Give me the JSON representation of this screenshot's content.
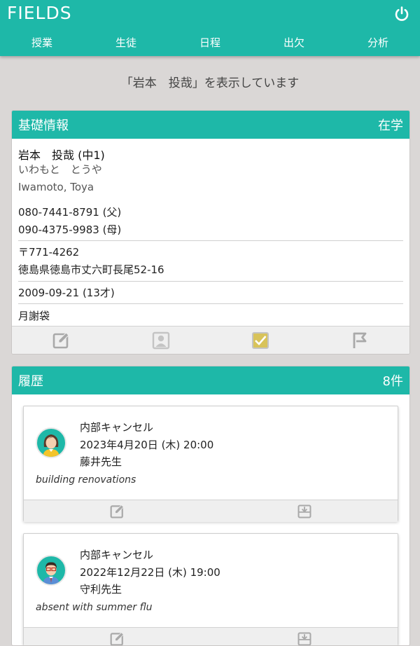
{
  "app": {
    "title": "FIELDS"
  },
  "nav": [
    {
      "label": "授業"
    },
    {
      "label": "生徒"
    },
    {
      "label": "日程"
    },
    {
      "label": "出欠"
    },
    {
      "label": "分析"
    }
  ],
  "message": "「岩本　投哉」を表示しています",
  "basic": {
    "header": "基礎情報",
    "status": "在学",
    "name": "岩本　投哉 (中1)",
    "kana": "いわもと　とうや",
    "roman": "Iwamoto, Toya",
    "phones": [
      "080-7441-8791 (父)",
      "090-4375-9983 (母)"
    ],
    "postal": "〒771-4262",
    "address": "徳島県徳島市丈六町長尾52-16",
    "birthday": "2009-09-21 (13才)",
    "fee": "月謝袋",
    "tools": [
      "edit-icon",
      "person-icon",
      "checkbox-icon",
      "flag-icon"
    ]
  },
  "history": {
    "header": "履歴",
    "count": "8件",
    "items": [
      {
        "type": "内部キャンセル",
        "datetime": "2023年4月20日 (木) 20:00",
        "teacher": "藤井先生",
        "note": "building renovations"
      },
      {
        "type": "内部キャンセル",
        "datetime": "2022年12月22日 (木) 19:00",
        "teacher": "守利先生",
        "note": "absent with summer flu"
      }
    ]
  },
  "colors": {
    "accent": "#1eb8a8",
    "background": "#dad7d6",
    "icon_gray": "#a9a9a9",
    "check_yellow": "#d8c35a"
  }
}
